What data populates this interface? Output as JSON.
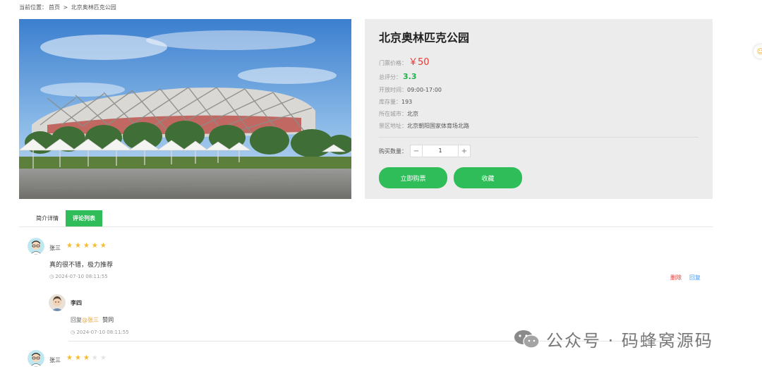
{
  "breadcrumb": {
    "label": "当前位置：",
    "home": "首页",
    "sep": ">",
    "current": "北京奥林匹克公园"
  },
  "attraction": {
    "title": "北京奥林匹克公园",
    "price_label": "门票价格：",
    "price_value": "￥50",
    "score_label": "总评分：",
    "score_value": "3.3",
    "hours_label": "开放时间：",
    "hours_value": "09:00-17:00",
    "stock_label": "库存量：",
    "stock_value": "193",
    "city_label": "所在城市：",
    "city_value": "北京",
    "address_label": "景区地址：",
    "address_value": "北京朝阳国家体育场北路"
  },
  "purchase": {
    "qty_label": "购买数量：",
    "minus": "−",
    "qty_value": "1",
    "plus": "+",
    "buy_label": "立即购票",
    "fav_label": "收藏"
  },
  "tabs": [
    "简介详情",
    "评论列表"
  ],
  "comments": [
    {
      "name": "张三",
      "rating": 5,
      "text": "真的很不错，极力推荐",
      "time_icon": "clock-icon",
      "time": "2024-07-10 08:11:55",
      "delete_label": "删除",
      "reply_label": "回复",
      "replies": [
        {
          "name": "李四",
          "reply_prefix": "回复",
          "mention": "@张三",
          "text": "赞同",
          "time": "2024-07-10 08:11:55"
        }
      ]
    },
    {
      "name": "张三",
      "rating": 3
    }
  ],
  "watermark": {
    "icon": "wechat-icon",
    "text": "公众号 · 码蜂窝源码"
  },
  "colors": {
    "accent": "#2ebd59",
    "price": "#e53935",
    "star": "#f7ba2a",
    "link": "#409eff"
  }
}
